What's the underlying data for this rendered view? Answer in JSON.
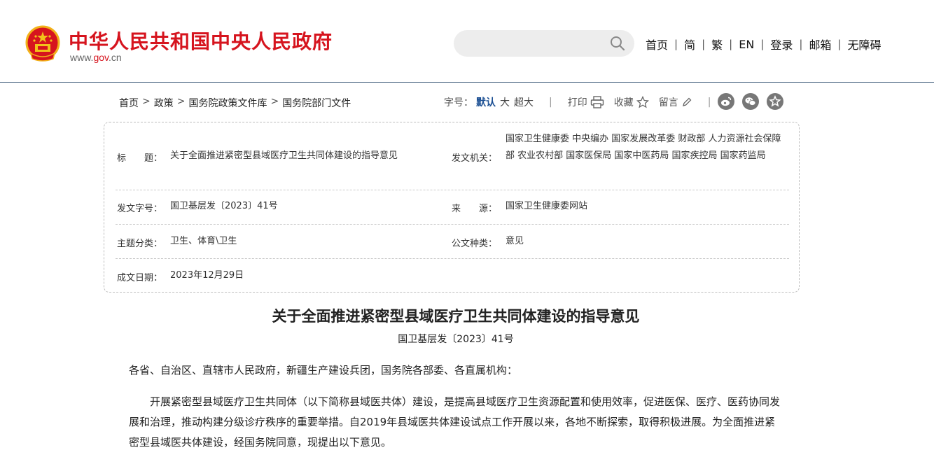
{
  "header": {
    "site_title": "中华人民共和国中央人民政府",
    "site_url_prefix": "www.",
    "site_url_accent": "gov",
    "site_url_suffix": ".cn",
    "search_placeholder": "",
    "search_icon": "search-icon",
    "nav": [
      "首页",
      "简",
      "繁",
      "EN",
      "登录",
      "邮箱",
      "无障碍"
    ]
  },
  "breadcrumb": [
    "首页",
    "政策",
    "国务院政策文件库",
    "国务院部门文件"
  ],
  "tools": {
    "font_size_label": "字号：",
    "font_default": "默认",
    "font_large": "大",
    "font_xlarge": "超大",
    "print": "打印",
    "favorite": "收藏",
    "comment": "留言",
    "share_icons": [
      "weibo-icon",
      "wechat-icon",
      "star-icon"
    ]
  },
  "info": {
    "title_label": "标　　题：",
    "title_value": "关于全面推进紧密型县域医疗卫生共同体建设的指导意见",
    "issuer_label": "发文机关：",
    "issuer_value": "国家卫生健康委 中央编办 国家发展改革委 财政部 人力资源社会保障部 农业农村部 国家医保局 国家中医药局 国家疾控局 国家药监局",
    "docno_label": "发文字号：",
    "docno_value": "国卫基层发〔2023〕41号",
    "source_label": "来　　源：",
    "source_value": "国家卫生健康委网站",
    "topic_label": "主题分类：",
    "topic_value": "卫生、体育\\卫生",
    "type_label": "公文种类：",
    "type_value": "意见",
    "date_label": "成文日期：",
    "date_value": "2023年12月29日"
  },
  "article": {
    "title": "关于全面推进紧密型县域医疗卫生共同体建设的指导意见",
    "code": "国卫基层发〔2023〕41号",
    "addressee": "各省、自治区、直辖市人民政府，新疆生产建设兵团，国务院各部委、各直属机构：",
    "paragraph": "开展紧密型县域医疗卫生共同体（以下简称县域医共体）建设，是提高县域医疗卫生资源配置和使用效率，促进医保、医疗、医药协同发展和治理，推动构建分级诊疗秩序的重要举措。自2019年县域医共体建设试点工作开展以来，各地不断探索，取得积极进展。为全面推进紧密型县域医共体建设，经国务院同意，现提出以下意见。"
  },
  "colors": {
    "brand_red": "#d6141e",
    "accent_blue": "#1b4f93",
    "header_line": "#3c5a78"
  }
}
